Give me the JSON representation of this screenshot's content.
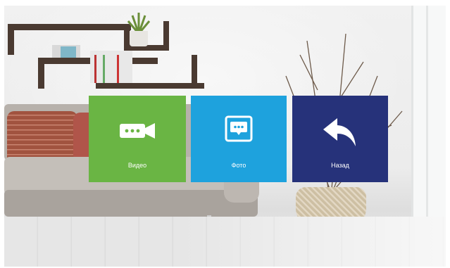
{
  "menu": {
    "items": [
      {
        "id": "video",
        "label": "Видео",
        "icon": "video-camera-icon",
        "color": "#6ab544"
      },
      {
        "id": "photo",
        "label": "Фото",
        "icon": "photo-message-icon",
        "color": "#1ea2dd"
      },
      {
        "id": "back",
        "label": "Назад",
        "icon": "back-arrow-icon",
        "color": "#26327a"
      }
    ]
  },
  "background": {
    "scene": "living-room-wallpaper"
  }
}
